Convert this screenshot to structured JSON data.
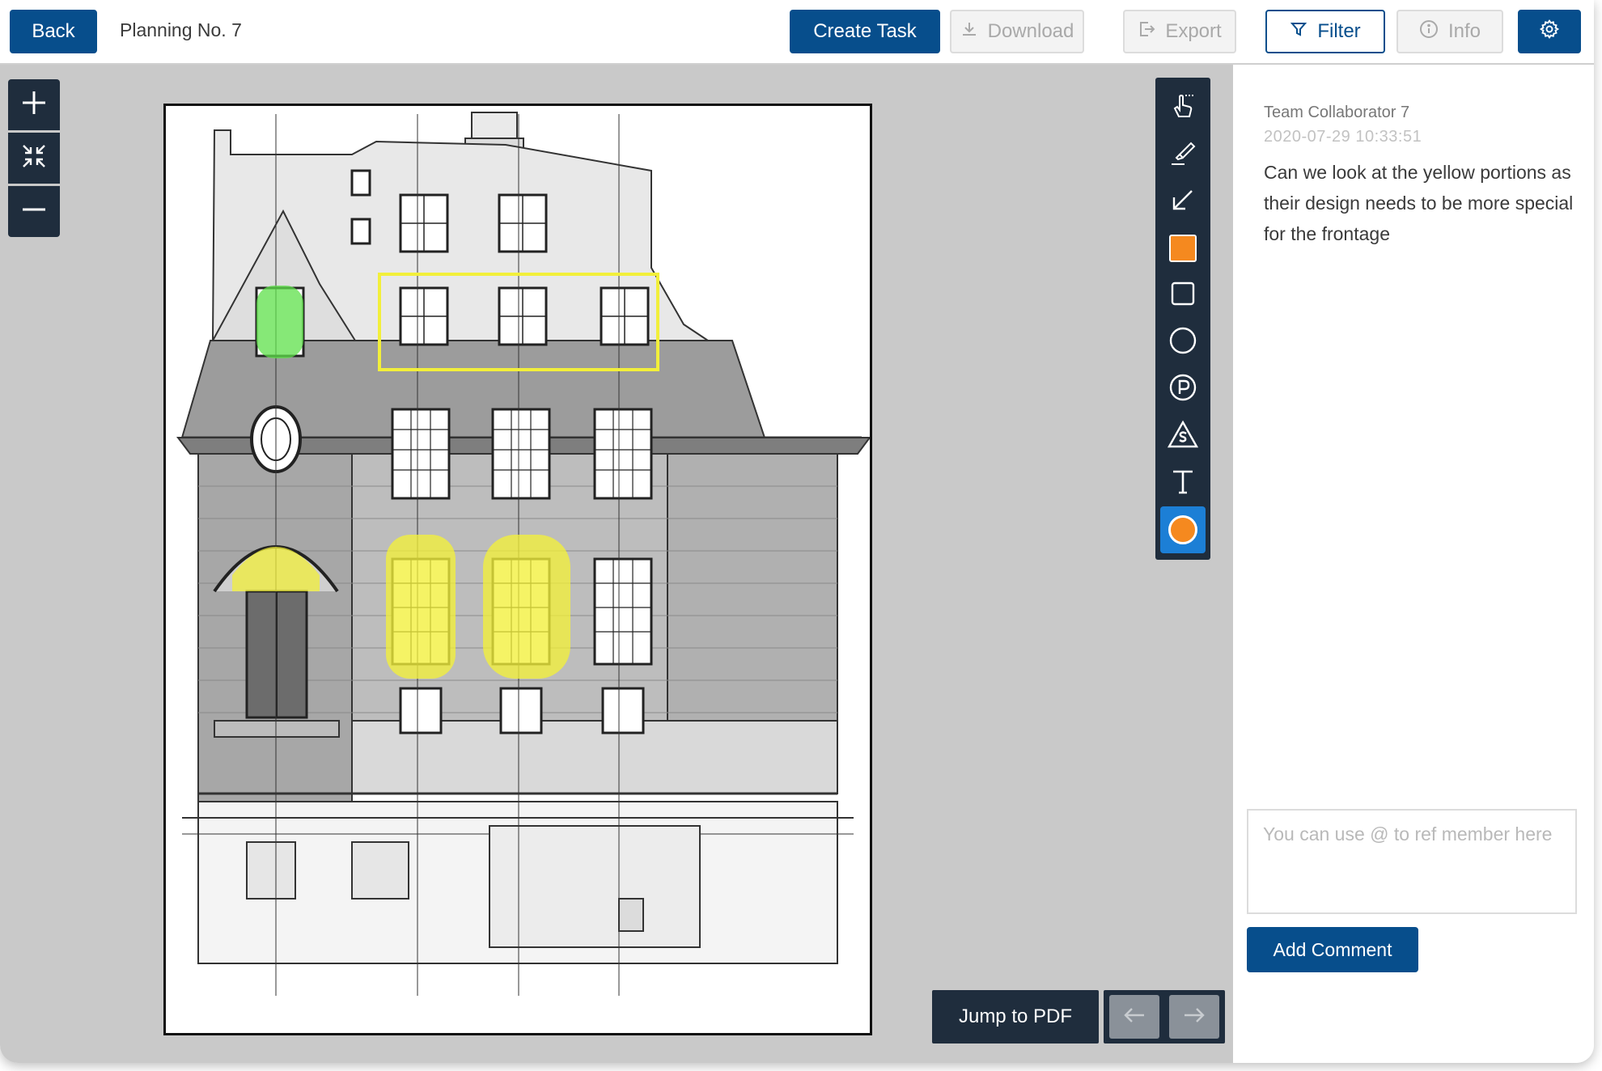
{
  "header": {
    "back_label": "Back",
    "title": "Planning No. 7",
    "create_task_label": "Create Task",
    "download_label": "Download",
    "export_label": "Export",
    "filter_label": "Filter",
    "info_label": "Info",
    "settings_icon": "gear-icon"
  },
  "zoom_controls": [
    "zoom-in-icon",
    "collapse-icon",
    "zoom-out-icon"
  ],
  "tools": [
    {
      "icon": "pointer-hand-icon"
    },
    {
      "icon": "highlighter-icon"
    },
    {
      "icon": "arrow-icon"
    },
    {
      "icon": "fill-color-swatch",
      "color": "#f5891f"
    },
    {
      "icon": "rectangle-icon"
    },
    {
      "icon": "circle-icon"
    },
    {
      "icon": "parking-p-icon"
    },
    {
      "icon": "warning-s-icon"
    },
    {
      "icon": "text-icon"
    },
    {
      "icon": "stroke-color-swatch",
      "color": "#f5891f",
      "active": true
    }
  ],
  "navigation": {
    "jump_label": "Jump to PDF",
    "prev_icon": "arrow-left-icon",
    "next_icon": "arrow-right-icon"
  },
  "panel": {
    "author": "Team Collaborator 7",
    "timestamp": "2020-07-29 10:33:51",
    "comment": "Can we look at the yellow portions as their design needs to be more special for the frontage",
    "input_placeholder": "You can use @ to ref member here",
    "add_comment_label": "Add Comment"
  },
  "colors": {
    "primary": "#074e8c",
    "toolbar": "#1f2d3d",
    "active_tool": "#1c7fd6",
    "accent_orange": "#f5891f",
    "highlight_yellow": "#f2ef3a",
    "highlight_green": "#5ee04a"
  }
}
